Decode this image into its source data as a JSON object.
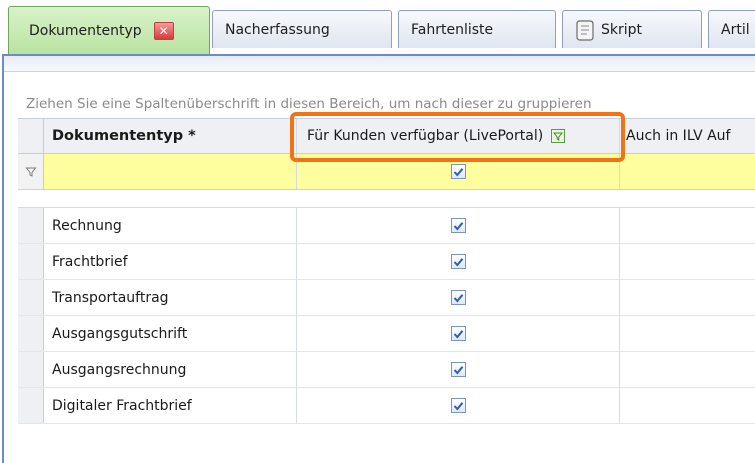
{
  "tabs": [
    {
      "label": "Dokumententyp",
      "active": true,
      "closable": true
    },
    {
      "label": "Nacherfassung",
      "active": false
    },
    {
      "label": "Fahrtenliste",
      "active": false
    },
    {
      "label": "Skript",
      "active": false,
      "icon": "script-icon"
    },
    {
      "label": "Artil",
      "active": false
    }
  ],
  "group_hint": "Ziehen Sie eine Spaltenüberschrift in diesen Bereich, um nach dieser zu gruppieren",
  "columns": {
    "dokumententyp": "Dokumententyp *",
    "kunden": "Für Kunden verfügbar (LivePortal)",
    "ilv": "Auch in ILV Auf"
  },
  "filter_row": {
    "kunden_checked": true
  },
  "rows": [
    {
      "dokumententyp": "Rechnung",
      "kunden_checked": true
    },
    {
      "dokumententyp": "Frachtbrief",
      "kunden_checked": true
    },
    {
      "dokumententyp": "Transportauftrag",
      "kunden_checked": true
    },
    {
      "dokumententyp": "Ausgangsgutschrift",
      "kunden_checked": true
    },
    {
      "dokumententyp": "Ausgangsrechnung",
      "kunden_checked": true
    },
    {
      "dokumententyp": "Digitaler Frachtbrief",
      "kunden_checked": true
    }
  ],
  "colors": {
    "active_tab": "#b9e3a0",
    "filter_row": "#fffe9e",
    "highlight": "#f07318",
    "panel_border": "#6e8cc4"
  }
}
